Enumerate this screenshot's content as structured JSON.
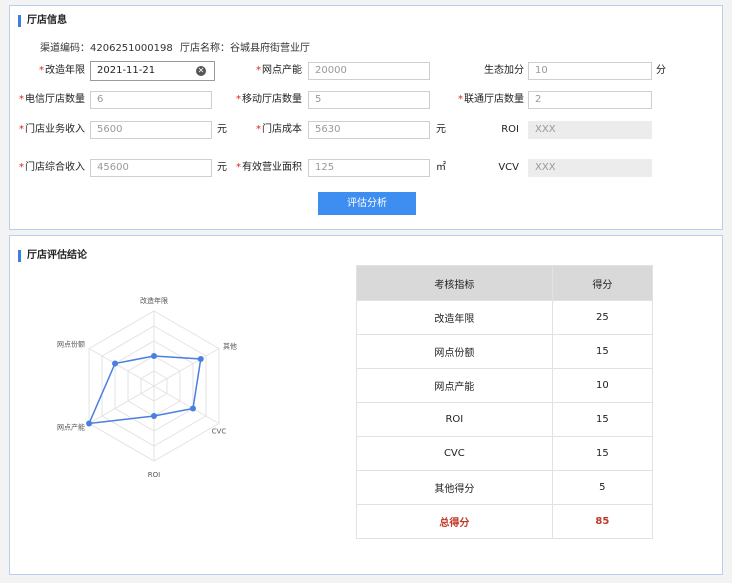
{
  "info": {
    "title": "厅店信息",
    "channel_code_label": "渠道编码：",
    "channel_code": "4206251000198",
    "store_name_label": "厅店名称：",
    "store_name": "谷城县府街营业厅",
    "fields": {
      "renovation_year": {
        "label": "改造年限",
        "value": "2021-11-21"
      },
      "outlet_capacity": {
        "label": "网点产能",
        "value": "20000"
      },
      "eco_bonus": {
        "label": "生态加分",
        "value": "10",
        "unit": "分"
      },
      "telecom_count": {
        "label": "电信厅店数量",
        "value": "6"
      },
      "mobile_count": {
        "label": "移动厅店数量",
        "value": "5"
      },
      "unicom_count": {
        "label": "联通厅店数量",
        "value": "2"
      },
      "business_income": {
        "label": "门店业务收入",
        "value": "5600",
        "unit": "元"
      },
      "store_cost": {
        "label": "门店成本",
        "value": "5630",
        "unit": "元"
      },
      "roi": {
        "label": "ROI",
        "value": "XXX"
      },
      "total_income": {
        "label": "门店综合收入",
        "value": "45600",
        "unit": "元"
      },
      "business_area": {
        "label": "有效营业面积",
        "value": "125",
        "unit": "㎡"
      },
      "vcv": {
        "label": "VCV",
        "value": "XXX"
      }
    },
    "assess_button": "评估分析"
  },
  "conclusion": {
    "title": "厅店评估结论",
    "table": {
      "headers": [
        "考核指标",
        "得分"
      ],
      "rows": [
        [
          "改造年限",
          "25"
        ],
        [
          "网点份额",
          "15"
        ],
        [
          "网点产能",
          "10"
        ],
        [
          "ROI",
          "15"
        ],
        [
          "CVC",
          "15"
        ],
        [
          "其他得分",
          "5"
        ]
      ],
      "total": [
        "总得分",
        "85"
      ]
    }
  },
  "chart_data": {
    "type": "radar",
    "indicators": [
      "改造年限",
      "其他",
      "CVC",
      "ROI",
      "网点产能",
      "网点份额"
    ],
    "values": [
      0.4,
      0.72,
      0.6,
      0.4,
      1.0,
      0.6
    ],
    "max": 1,
    "rings": 5,
    "series_color": "#4a7fe0"
  }
}
